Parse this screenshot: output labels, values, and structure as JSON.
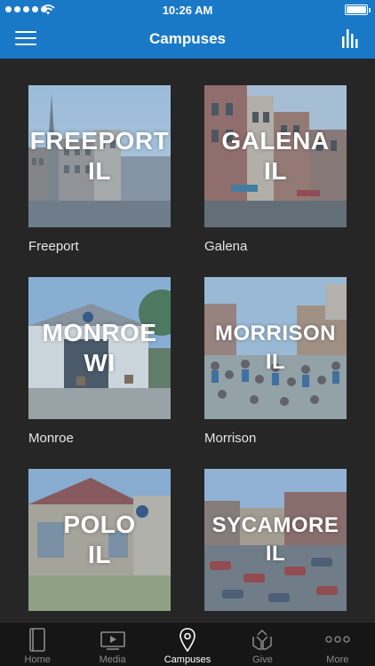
{
  "status_bar": {
    "time": "10:26 AM"
  },
  "nav": {
    "title": "Campuses"
  },
  "campuses": [
    {
      "tile_line1": "FREEPORT",
      "tile_line2": "IL",
      "name": "Freeport"
    },
    {
      "tile_line1": "GALENA",
      "tile_line2": "IL",
      "name": "Galena"
    },
    {
      "tile_line1": "MONROE",
      "tile_line2": "WI",
      "name": "Monroe"
    },
    {
      "tile_line1": "MORRISON",
      "tile_line2": "IL",
      "name": "Morrison"
    },
    {
      "tile_line1": "POLO",
      "tile_line2": "IL",
      "name": ""
    },
    {
      "tile_line1": "SYCAMORE",
      "tile_line2": "IL",
      "name": ""
    }
  ],
  "tabs": [
    {
      "label": "Home",
      "icon": "book-icon"
    },
    {
      "label": "Media",
      "icon": "play-icon"
    },
    {
      "label": "Campuses",
      "icon": "location-pin-icon",
      "active": true
    },
    {
      "label": "Give",
      "icon": "hands-icon"
    },
    {
      "label": "More",
      "icon": "more-dots-icon"
    }
  ],
  "colors": {
    "brand": "#1a79c7",
    "background": "#262626",
    "tab_bar": "#161616"
  }
}
